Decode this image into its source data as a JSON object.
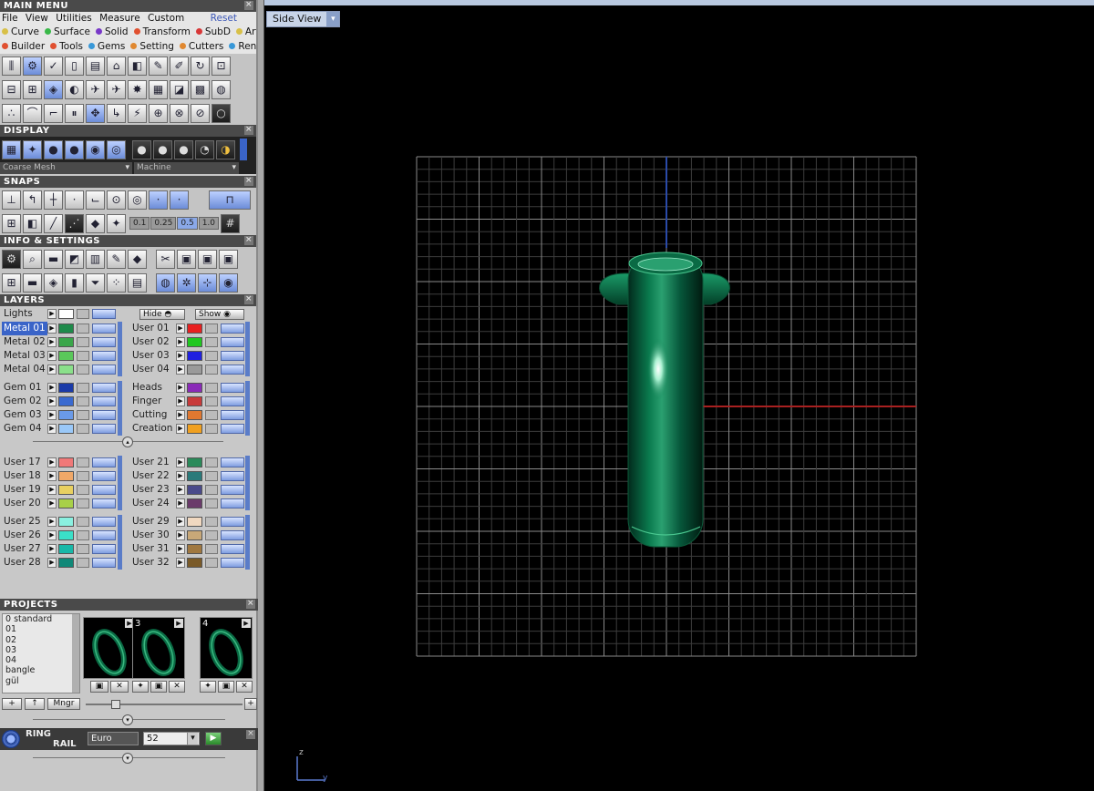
{
  "main_menu": {
    "title": "MAIN MENU",
    "menus": [
      "File",
      "View",
      "Utilities",
      "Measure",
      "Custom"
    ],
    "reset": "Reset",
    "tabs_row1": [
      {
        "label": "Curve",
        "color": "#d8c048"
      },
      {
        "label": "Surface",
        "color": "#38b848"
      },
      {
        "label": "Solid",
        "color": "#7838c8"
      },
      {
        "label": "Transform",
        "color": "#e05030"
      },
      {
        "label": "SubD",
        "color": "#d83838"
      },
      {
        "label": "Art",
        "color": "#d8c048"
      }
    ],
    "tabs_row2": [
      {
        "label": "Builder",
        "color": "#e05030"
      },
      {
        "label": "Tools",
        "color": "#e05030"
      },
      {
        "label": "Gems",
        "color": "#3898d8"
      },
      {
        "label": "Setting",
        "color": "#e08830"
      },
      {
        "label": "Cutters",
        "color": "#e08830"
      },
      {
        "label": "Render",
        "color": "#3898d8"
      }
    ]
  },
  "display": {
    "title": "DISPLAY",
    "mesh": "Coarse Mesh",
    "material": "Machine"
  },
  "snaps": {
    "title": "SNAPS",
    "values": [
      "0.1",
      "0.25",
      "0.5",
      "1.0"
    ]
  },
  "info": {
    "title": "INFO & SETTINGS"
  },
  "layers": {
    "title": "LAYERS",
    "lights": "Lights",
    "hide": "Hide",
    "show": "Show",
    "groups": [
      {
        "left": [
          {
            "name": "Metal 01",
            "color": "#1e8a4a",
            "selected": true
          },
          {
            "name": "Metal 02",
            "color": "#3aa64a"
          },
          {
            "name": "Metal 03",
            "color": "#5ac85a"
          },
          {
            "name": "Metal 04",
            "color": "#8ae08a"
          }
        ],
        "right": [
          {
            "name": "User 01",
            "color": "#e82020"
          },
          {
            "name": "User 02",
            "color": "#20c820"
          },
          {
            "name": "User 03",
            "color": "#2020e0"
          },
          {
            "name": "User 04",
            "color": "#9a9a9a"
          }
        ]
      },
      {
        "left": [
          {
            "name": "Gem 01",
            "color": "#1a3aa8"
          },
          {
            "name": "Gem 02",
            "color": "#3a6ad0"
          },
          {
            "name": "Gem 03",
            "color": "#6a9ae8"
          },
          {
            "name": "Gem 04",
            "color": "#9ac8f8"
          }
        ],
        "right": [
          {
            "name": "Heads",
            "color": "#8a2ab8"
          },
          {
            "name": "Finger",
            "color": "#c83a3a"
          },
          {
            "name": "Cutting",
            "color": "#e07830"
          },
          {
            "name": "Creation",
            "color": "#f0a020"
          }
        ]
      },
      {
        "left": [
          {
            "name": "User 17",
            "color": "#f07878"
          },
          {
            "name": "User 18",
            "color": "#f0a868"
          },
          {
            "name": "User 19",
            "color": "#e8d060"
          },
          {
            "name": "User 20",
            "color": "#a8d048"
          }
        ],
        "right": [
          {
            "name": "User 21",
            "color": "#2a8a5a"
          },
          {
            "name": "User 22",
            "color": "#2a7a7a"
          },
          {
            "name": "User 23",
            "color": "#4a4a8a"
          },
          {
            "name": "User 24",
            "color": "#6a3a6a"
          }
        ]
      },
      {
        "left": [
          {
            "name": "User 25",
            "color": "#8af0e0"
          },
          {
            "name": "User 26",
            "color": "#3ae0c8"
          },
          {
            "name": "User 27",
            "color": "#18b8a8"
          },
          {
            "name": "User 28",
            "color": "#108878"
          }
        ],
        "right": [
          {
            "name": "User 29",
            "color": "#f0d8c0"
          },
          {
            "name": "User 30",
            "color": "#c8a878"
          },
          {
            "name": "User 31",
            "color": "#a07840"
          },
          {
            "name": "User 32",
            "color": "#7a5a28"
          }
        ]
      }
    ]
  },
  "projects": {
    "title": "PROJECTS",
    "list": [
      "0 standard",
      "01",
      "02",
      "03",
      "04",
      "bangle",
      "gül"
    ],
    "thumbnails": [
      "",
      "3",
      "4"
    ],
    "manager": "Mngr"
  },
  "ring_rail": {
    "title_line1": "RING",
    "title_line2": "RAIL",
    "standard": "Euro",
    "size": "52"
  },
  "viewport": {
    "view_label": "Side View",
    "axis_v": "z",
    "axis_h": "y"
  }
}
